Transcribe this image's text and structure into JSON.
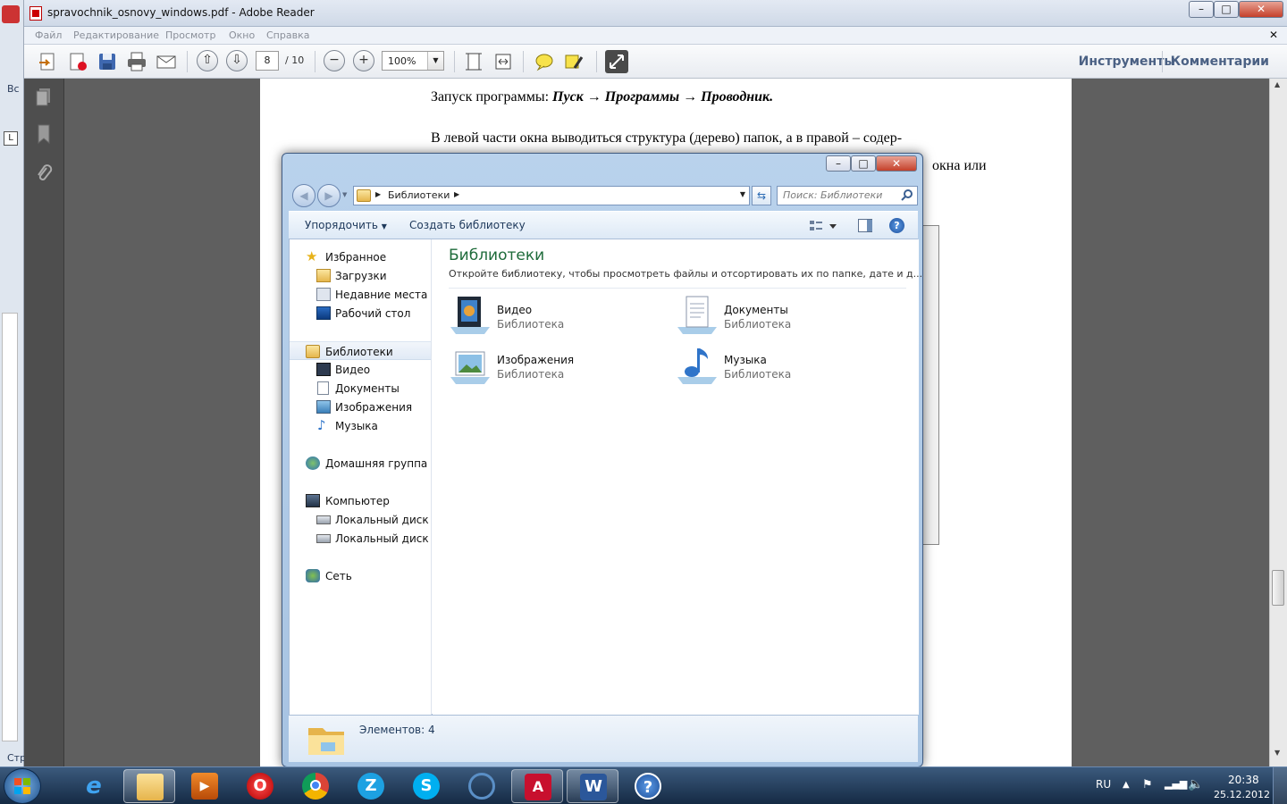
{
  "reader": {
    "title": "spravochnik_osnovy_windows.pdf - Adobe Reader",
    "menu": [
      "Файл",
      "Редактирование",
      "Просмотр",
      "Окно",
      "Справка"
    ],
    "page_current": "8",
    "page_total": "/ 10",
    "zoom": "100%",
    "tools_label": "Инструменты",
    "comments_label": "Комментарии",
    "page_text": {
      "line1_prefix": "Запуск программы: ",
      "line1_path": "Пуск → Программы → Проводник.",
      "line2_left": "В левой части окна выводиться структура (дерево) папок, а в правой – содер-",
      "line3_right": "окна или"
    }
  },
  "bg_left": {
    "label_top": "Вс",
    "label_bottom": "Стр"
  },
  "explorer": {
    "address_root": "Библиотеки",
    "search_placeholder": "Поиск: Библиотеки",
    "cmd": {
      "organize": "Упорядочить",
      "new_library": "Создать библиотеку"
    },
    "nav": {
      "favorites": "Избранное",
      "downloads": "Загрузки",
      "recent": "Недавние места",
      "desktop": "Рабочий стол",
      "libraries": "Библиотеки",
      "video": "Видео",
      "documents": "Документы",
      "images": "Изображения",
      "music": "Музыка",
      "homegroup": "Домашняя группа",
      "computer": "Компьютер",
      "disk_c": "Локальный диск C",
      "disk_d": "Локальный диск D",
      "network": "Сеть"
    },
    "content": {
      "heading": "Библиотеки",
      "subheading": "Откройте библиотеку, чтобы просмотреть файлы и отсортировать их по папке, дате и д...",
      "libraries": [
        {
          "name": "Видео",
          "type": "Библиотека",
          "icon": "video-library-icon"
        },
        {
          "name": "Документы",
          "type": "Библиотека",
          "icon": "documents-library-icon"
        },
        {
          "name": "Изображения",
          "type": "Библиотека",
          "icon": "images-library-icon"
        },
        {
          "name": "Музыка",
          "type": "Библиотека",
          "icon": "music-library-icon"
        }
      ]
    },
    "status": "Элементов: 4"
  },
  "taskbar": {
    "lang": "RU",
    "time": "20:38",
    "date": "25.12.2012"
  },
  "colors": {
    "explorer_heading": "#1e6b3a",
    "reader_bg": "#5f5f5f",
    "taskbar": "#1f3a5c"
  }
}
